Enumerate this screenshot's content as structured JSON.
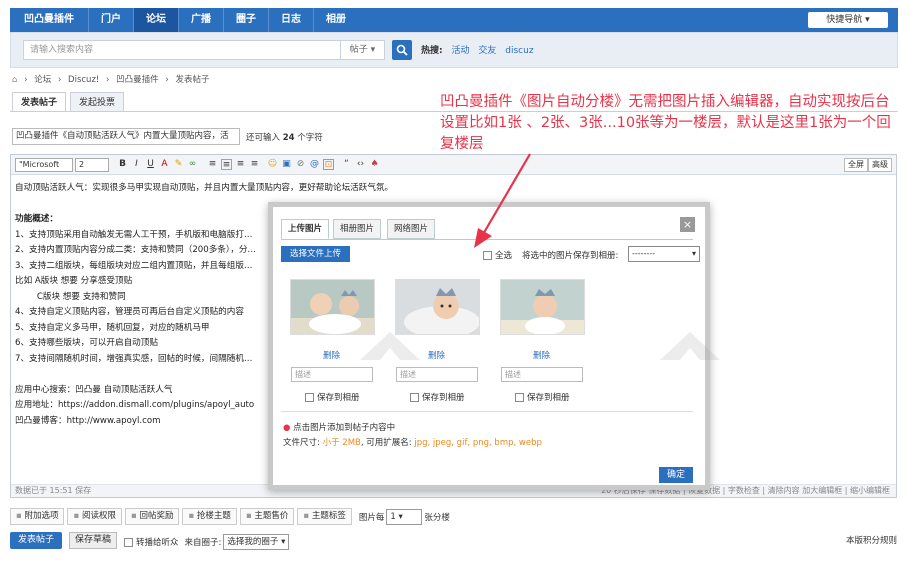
{
  "nav": {
    "brand": "凹凸曼插件",
    "items": [
      "门户",
      "论坛",
      "广播",
      "圈子",
      "日志",
      "相册"
    ],
    "quicknav": "快捷导航 ▾"
  },
  "search": {
    "placeholder": "请输入搜索内容",
    "type": "帖子 ▾",
    "hot_label": "热搜:",
    "hot_items": [
      "活动",
      "交友",
      "discuz"
    ]
  },
  "breadcrumb": [
    "论坛",
    "Discuz!",
    "凹凸曼插件",
    "发表帖子"
  ],
  "tabs": [
    "发表帖子",
    "发起投票"
  ],
  "subject": "凹凸曼插件《自动顶贴活跃人气》内置大量顶贴内容，活",
  "char_hint": {
    "pre": "还可输入",
    "count": "24",
    "post": "个字符"
  },
  "toolbar": {
    "font": "\"Microsoft",
    "size": "2",
    "fullscreen": "全屏",
    "advanced": "高级"
  },
  "content_lines": [
    "自动顶贴活跃人气：实现很多马甲实现自动顶贴，并且内置大量顶贴内容，更好帮助论坛活跃气氛。",
    "",
    "功能概述：",
    "1、支持顶贴采用自动触发无需人工干预，手机版和电脑版打…",
    "2、支持内置顶贴内容分成二类：支持和赞同（200多条），分…",
    "3、支持二组版块，每组版块对应二组内置顶贴，并且每组版…",
    "比如 A版块 想要 分享感受顶贴",
    "        C版块 想要 支持和赞同",
    "4、支持自定义顶贴内容，管理员可再后台自定义顶贴的内容",
    "5、支持自定义多马甲，随机回复，对应的随机马甲",
    "6、支持哪些版块，可以开启自动顶贴",
    "7、支持间隔随机时间，增强真实感，回帖的时候，间隔随机…",
    "",
    "应用中心搜索：凹凸曼 自动顶贴活跃人气",
    "应用地址：https://addon.dismall.com/plugins/apoyl_auto",
    "凹凸曼博客：http://www.apoyl.com"
  ],
  "editor_status": {
    "left": "数据已于 15:51 保存",
    "right": "20 秒后保存 保存数据 | 恢复数据 | 字数检查 | 清除内容    加大编辑框 | 缩小编辑框"
  },
  "options": [
    "附加选项",
    "阅读权限",
    "回帖奖励",
    "抢楼主题",
    "主题售价",
    "主题标签"
  ],
  "per_image": {
    "pre": "图片每",
    "value": "1",
    "post": "张分楼"
  },
  "submit_label": "发表帖子",
  "draft_label": "保存草稿",
  "bottom": {
    "listen": "转播给听众",
    "from_circle": "来自圈子:",
    "circle_select": "选择我的圈子",
    "rules": "本版积分规则"
  },
  "dialog": {
    "tabs": [
      "上传图片",
      "相册图片",
      "网络图片"
    ],
    "upload_button": "选择文件上传",
    "select_all": "全选",
    "save_to_album_label": "将选中的图片保存到相册:",
    "album_value": "--------",
    "photos": [
      {
        "delete": "删除",
        "desc": "描述",
        "save": "保存到相册"
      },
      {
        "delete": "删除",
        "desc": "描述",
        "save": "保存到相册"
      },
      {
        "delete": "删除",
        "desc": "描述",
        "save": "保存到相册"
      }
    ],
    "hint": "点击图片添加到帖子内容中",
    "size_pre": "文件尺寸:",
    "size_val": "小于 2MB",
    "ext_pre": ", 可用扩展名:",
    "ext_val": "jpg, jpeg, gif, png, bmp, webp",
    "confirm": "确定"
  },
  "annotation": "凹凸曼插件《图片自动分楼》无需把图片插入编辑器，自动实现按后台设置比如1张 、2张、3张...10张等为一楼层，默认是这里1张为一个回复楼层",
  "colors": {
    "brand": "#2b6fbf",
    "annotation": "#e8344a",
    "accent": "#e88b1f"
  }
}
